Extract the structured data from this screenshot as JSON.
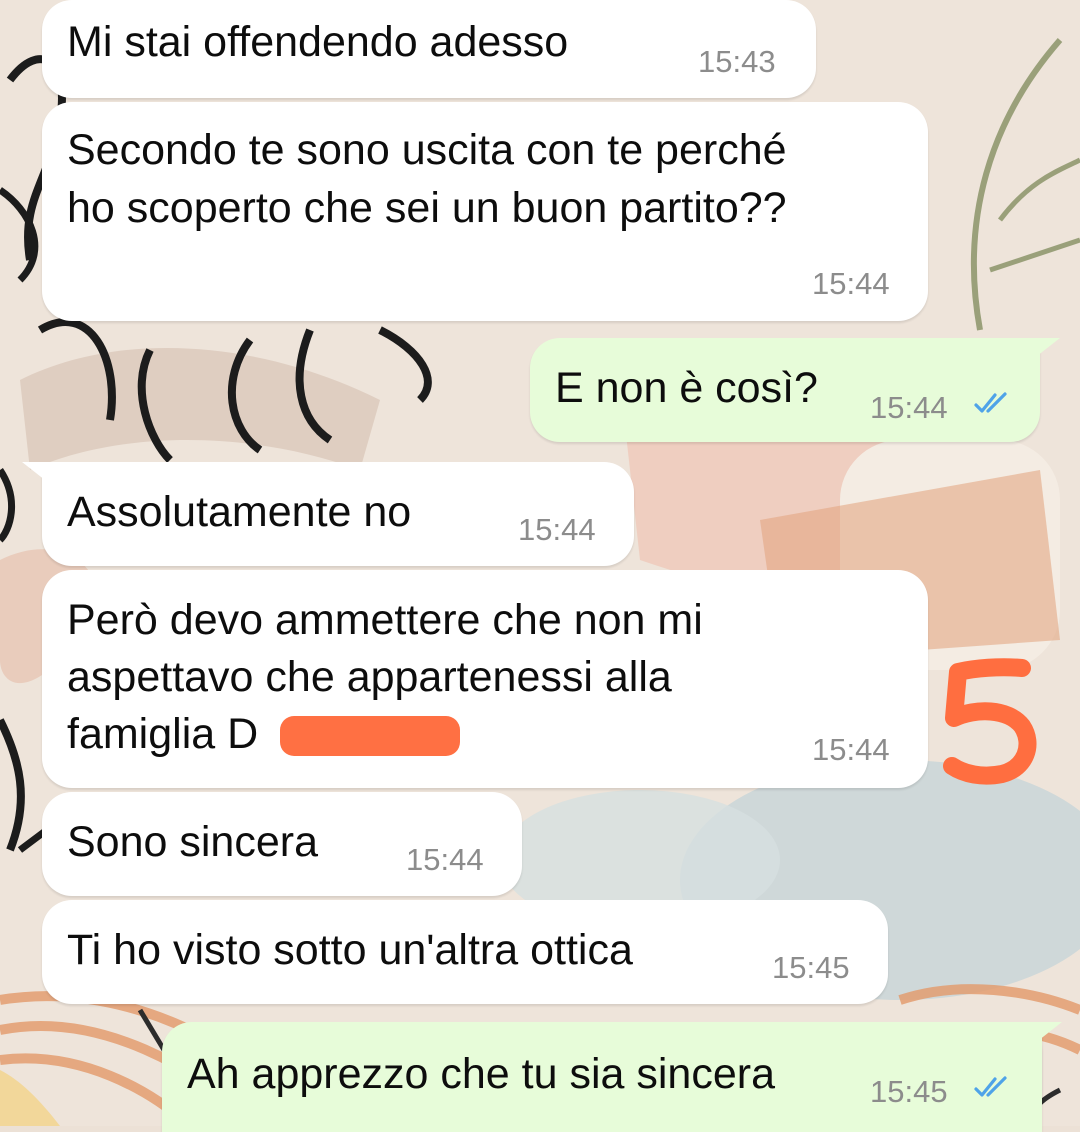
{
  "conversation": {
    "messages": [
      {
        "direction": "incoming",
        "text": "Mi stai offendendo adesso",
        "time": "15:43"
      },
      {
        "direction": "incoming",
        "lines": [
          "Secondo te sono uscita con te perché",
          "ho scoperto che sei un buon partito??"
        ],
        "time": "15:44"
      },
      {
        "direction": "outgoing",
        "text": "E non è così?",
        "time": "15:44",
        "status": "read"
      },
      {
        "direction": "incoming",
        "text": "Assolutamente no",
        "time": "15:44"
      },
      {
        "direction": "incoming",
        "lines": [
          "Però devo ammettere che non mi",
          "aspettavo che appartenessi alla",
          "famiglia D"
        ],
        "time": "15:44",
        "redacted": true
      },
      {
        "direction": "incoming",
        "text": "Sono sincera",
        "time": "15:44"
      },
      {
        "direction": "incoming",
        "text": "Ti ho visto sotto un'altra ottica",
        "time": "15:45"
      },
      {
        "direction": "outgoing",
        "text": "Ah apprezzo che tu sia sincera",
        "time": "15:45",
        "status": "read"
      }
    ]
  },
  "colors": {
    "incoming_bubble": "#ffffff",
    "outgoing_bubble": "#e7fcd9",
    "read_ticks": "#4fa3e8",
    "redaction": "#ff7043",
    "annotation": "#ff6e40"
  },
  "annotation": {
    "icon": "handwritten-number-five",
    "value": "5"
  }
}
